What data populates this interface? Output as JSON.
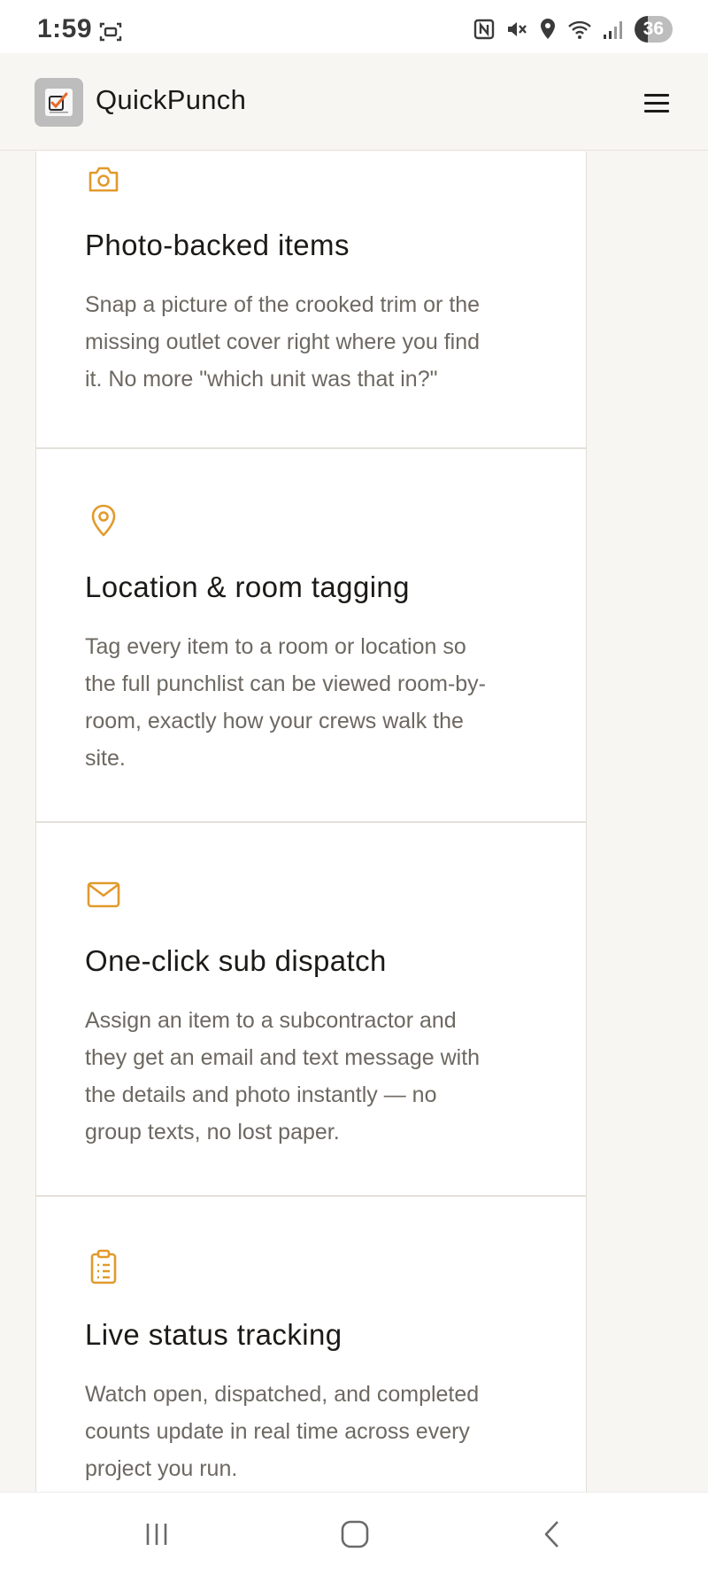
{
  "status_bar": {
    "time": "1:59",
    "battery_level": "36",
    "icons": [
      "screenshot-icon",
      "nfc-icon",
      "mute-icon",
      "location-icon",
      "wifi-icon",
      "signal-icon",
      "battery-icon"
    ]
  },
  "header": {
    "brand": "QuickPunch",
    "logo_icon": "quickpunch-logo",
    "menu_icon": "hamburger-menu-icon"
  },
  "colors": {
    "accent": "#e19a2c",
    "text_primary": "#1c1a17",
    "text_secondary": "#6d6861",
    "page_bg": "#f8f6f3"
  },
  "features": [
    {
      "icon": "camera-icon",
      "title": "Photo-backed items",
      "lines": [
        "Snap a picture of the crooked trim or the",
        "missing outlet cover right where you find",
        "it. No more \"which unit was that in?\""
      ]
    },
    {
      "icon": "map-pin-icon",
      "title": "Location & room tagging",
      "lines": [
        "Tag every item to a room or location so",
        "the full punchlist can be viewed room-by-",
        "room, exactly how your crews walk the",
        "site."
      ]
    },
    {
      "icon": "mail-icon",
      "title": "One-click sub dispatch",
      "lines": [
        "Assign an item to a subcontractor and",
        "they get an email and text message with",
        "the details and photo instantly — no",
        "group texts, no lost paper."
      ]
    },
    {
      "icon": "clipboard-list-icon",
      "title": "Live status tracking",
      "lines": [
        "Watch open, dispatched, and completed",
        "counts update in real time across every",
        "project you run."
      ]
    }
  ],
  "nav_bar": {
    "recents_icon": "recents-icon",
    "home_icon": "home-icon",
    "back_icon": "back-icon"
  }
}
